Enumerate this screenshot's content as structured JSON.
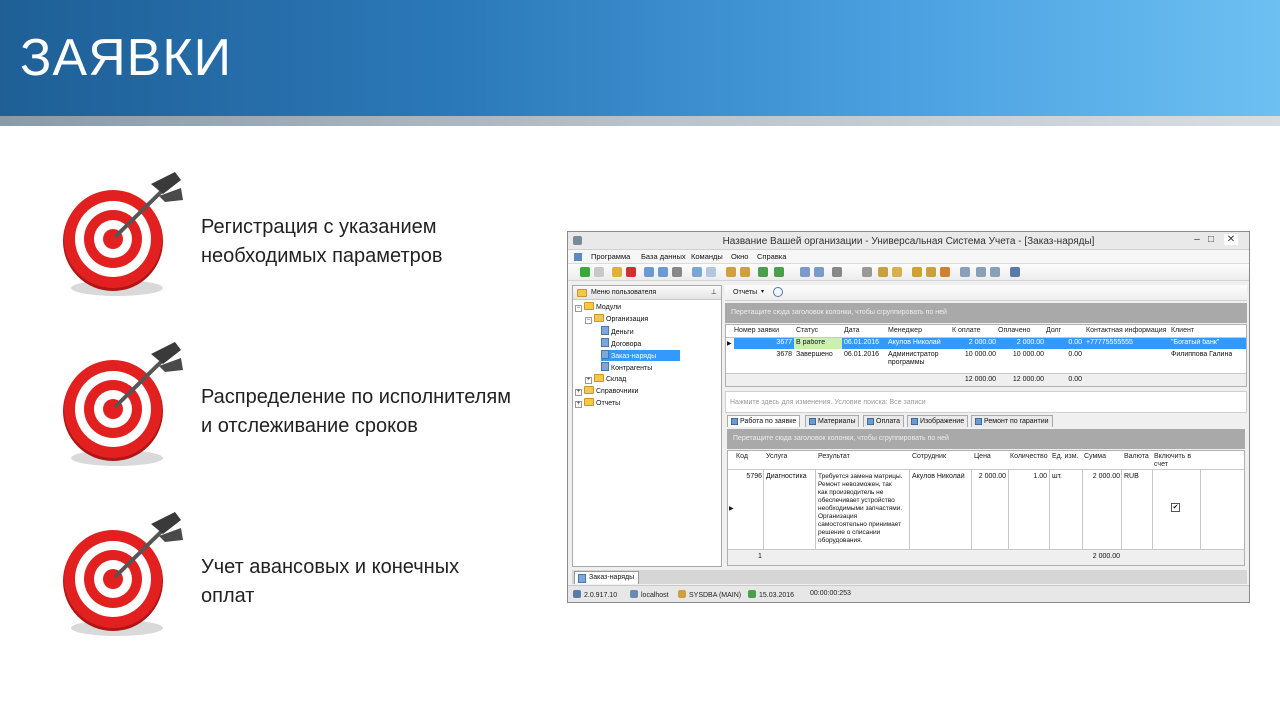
{
  "slide": {
    "title": "ЗАЯВКИ",
    "bullets": [
      {
        "line1": "Регистрация с указанием",
        "line2": "необходимых параметров",
        "icon": "target-icon"
      },
      {
        "line1": "Распределение по исполнителям",
        "line2": "и отслеживание сроков",
        "icon": "target-icon"
      },
      {
        "line1": "Учет авансовых и конечных",
        "line2": "оплат",
        "icon": "target-icon"
      }
    ]
  },
  "app": {
    "window_title": "Название Вашей организации - Универсальная Система Учета - [Заказ-наряды]",
    "menu": [
      "Программа",
      "База данных",
      "Команды",
      "Окно",
      "Справка"
    ],
    "left_pane_title": "Меню пользователя",
    "tree": {
      "modules": "Модули",
      "organization": "Организация",
      "money": "Деньги",
      "contracts": "Договора",
      "orders": "Заказ-наряды",
      "contractors": "Контрагенты",
      "warehouse": "Склад",
      "references": "Справочники",
      "reports": "Отчеты"
    },
    "reports_button": "Отчеты",
    "group_hint": "Перетащите сюда заголовок колонки, чтобы сгруппировать по ней",
    "orders_grid": {
      "columns": [
        "Номер заявки",
        "Статус",
        "Дата",
        "Менеджер",
        "К оплате",
        "Оплачено",
        "Долг",
        "Контактная информация",
        "Клиент"
      ],
      "rows": [
        {
          "num": "3677",
          "status": "В работе",
          "date": "06.01.2016",
          "manager": "Акулов Николай",
          "due": "2 000.00",
          "paid": "2 000.00",
          "debt": "0.00",
          "contact": "+77775555555",
          "client": "\"Богатый банк\""
        },
        {
          "num": "3678",
          "status": "Завершено",
          "date": "06.01.2016",
          "manager": "Администратор",
          "manager2": "программы",
          "due": "10 000.00",
          "paid": "10 000.00",
          "debt": "0.00",
          "contact": "",
          "client": "Филиппова Галина"
        }
      ],
      "totals": {
        "due": "12 000.00",
        "paid": "12 000.00",
        "debt": "0.00"
      }
    },
    "filter_hint": "Нажмите здесь для изменения. Условие поиска: Все записи",
    "tabs": [
      "Работа по заявке",
      "Материалы",
      "Оплата",
      "Изображение",
      "Ремонт по гарантии"
    ],
    "work_grid": {
      "columns": [
        "Код",
        "Услуга",
        "Результат",
        "Сотрудник",
        "Цена",
        "Количество",
        "Ед. изм.",
        "Сумма",
        "Валюта",
        "Включить в",
        "счет"
      ],
      "row": {
        "code": "5796",
        "service": "Диагностика",
        "result": [
          "Требуется замена матрицы.",
          "Ремонт невозможен, так",
          "как производитель не",
          "обеспечивает устройство",
          "необходимыми запчастями.",
          "Организация",
          "самостоятельно принимает",
          "решение о списании",
          "оборудования."
        ],
        "employee": "Акулов Николай",
        "price": "2 000.00",
        "qty": "1.00",
        "unit": "шт.",
        "sum": "2 000.00",
        "currency": "RUB",
        "checked": "✔"
      },
      "count": "1",
      "total_sum": "2 000.00"
    },
    "bottom_tab": "Заказ-наряды",
    "status": {
      "version": "2.0.917.10",
      "host": "localhost",
      "user": "SYSDBA (MAIN)",
      "date": "15.03.2016",
      "time": "00:00:00:253"
    }
  }
}
